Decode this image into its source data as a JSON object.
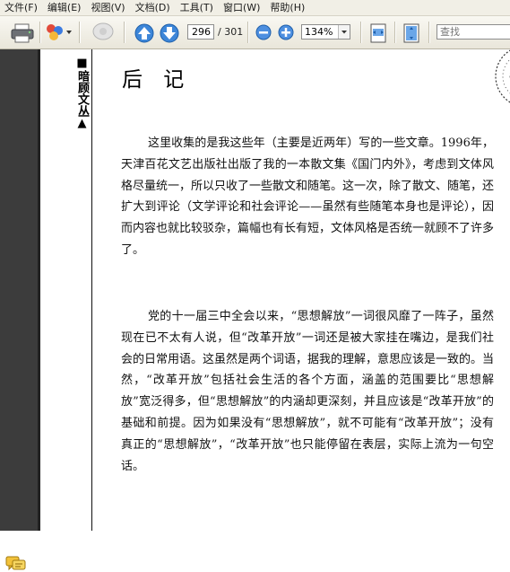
{
  "menu": [
    "文件(F)",
    "编辑(E)",
    "视图(V)",
    "文档(D)",
    "工具(T)",
    "窗口(W)",
    "帮助(H)"
  ],
  "toolbar": {
    "page_current": "296",
    "page_total": "/ 301",
    "zoom": "134%",
    "search_placeholder": "查找"
  },
  "document": {
    "side_title": "■暗顾文丛▲",
    "heading": "后 记",
    "paragraphs": [
      "这里收集的是我这些年（主要是近两年）写的一些文章。1996年，天津百花文艺出版社出版了我的一本散文集《国门内外》，考虑到文体风格尽量统一，所以只收了一些散文和随笔。这一次，除了散文、随笔，还扩大到评论（文学评论和社会评论——虽然有些随笔本身也是评论），因而内容也就比较驳杂，篇幅也有长有短，文体风格是否统一就顾不了许多了。",
      "党的十一届三中全会以来，“思想解放”一词很风靡了一阵子，虽然现在已不太有人说，但“改革开放”一词还是被大家挂在嘴边，是我们社会的日常用语。这虽然是两个词语，据我的理解，意思应该是一致的。当然，“改革开放”包括社会生活的各个方面，涵盖的范围要比“思想解放”宽泛得多，但“思想解放”的内涵却更深刻，并且应该是“改革开放”的基础和前提。因为如果没有“思想解放”，就不可能有“改革开放”；没有真正的“思想解放”，“改革开放”也只能停留在表层，实际上流为一句空话。"
    ]
  }
}
